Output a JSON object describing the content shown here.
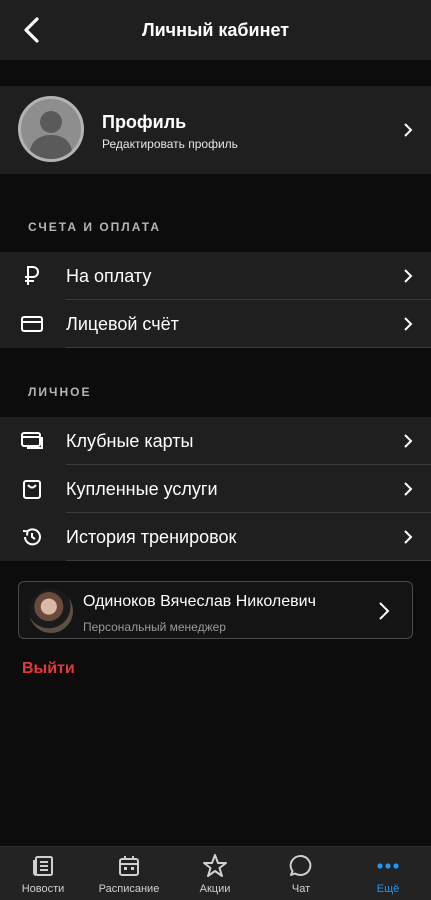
{
  "header": {
    "title": "Личный кабинет",
    "back_icon": "chevron-left-icon"
  },
  "profile": {
    "title": "Профиль",
    "subtitle": "Редактировать профиль"
  },
  "billing": {
    "section_label": "СЧЕТА И ОПЛАТА",
    "items": [
      {
        "label": "На оплату",
        "icon": "ruble-icon"
      },
      {
        "label": "Лицевой счёт",
        "icon": "card-icon"
      }
    ]
  },
  "personal": {
    "section_label": "ЛИЧНОЕ",
    "items": [
      {
        "label": "Клубные карты",
        "icon": "club-card-icon"
      },
      {
        "label": "Купленные услуги",
        "icon": "shopping-bag-icon"
      },
      {
        "label": "История тренировок",
        "icon": "history-icon"
      }
    ]
  },
  "manager": {
    "name": "Одиноков Вячеслав Николевич",
    "role": "Персональный менеджер"
  },
  "logout_label": "Выйти",
  "tabbar": {
    "items": [
      {
        "label": "Новости",
        "icon": "news-icon"
      },
      {
        "label": "Расписание",
        "icon": "calendar-icon"
      },
      {
        "label": "Акции",
        "icon": "star-icon"
      },
      {
        "label": "Чат",
        "icon": "chat-icon"
      },
      {
        "label": "Ещё",
        "icon": "more-icon"
      }
    ],
    "active": "Ещё"
  },
  "colors": {
    "accent": "#2196f3",
    "danger": "#e53935",
    "surface": "#1f1f1f",
    "background": "#0c0c0c"
  }
}
